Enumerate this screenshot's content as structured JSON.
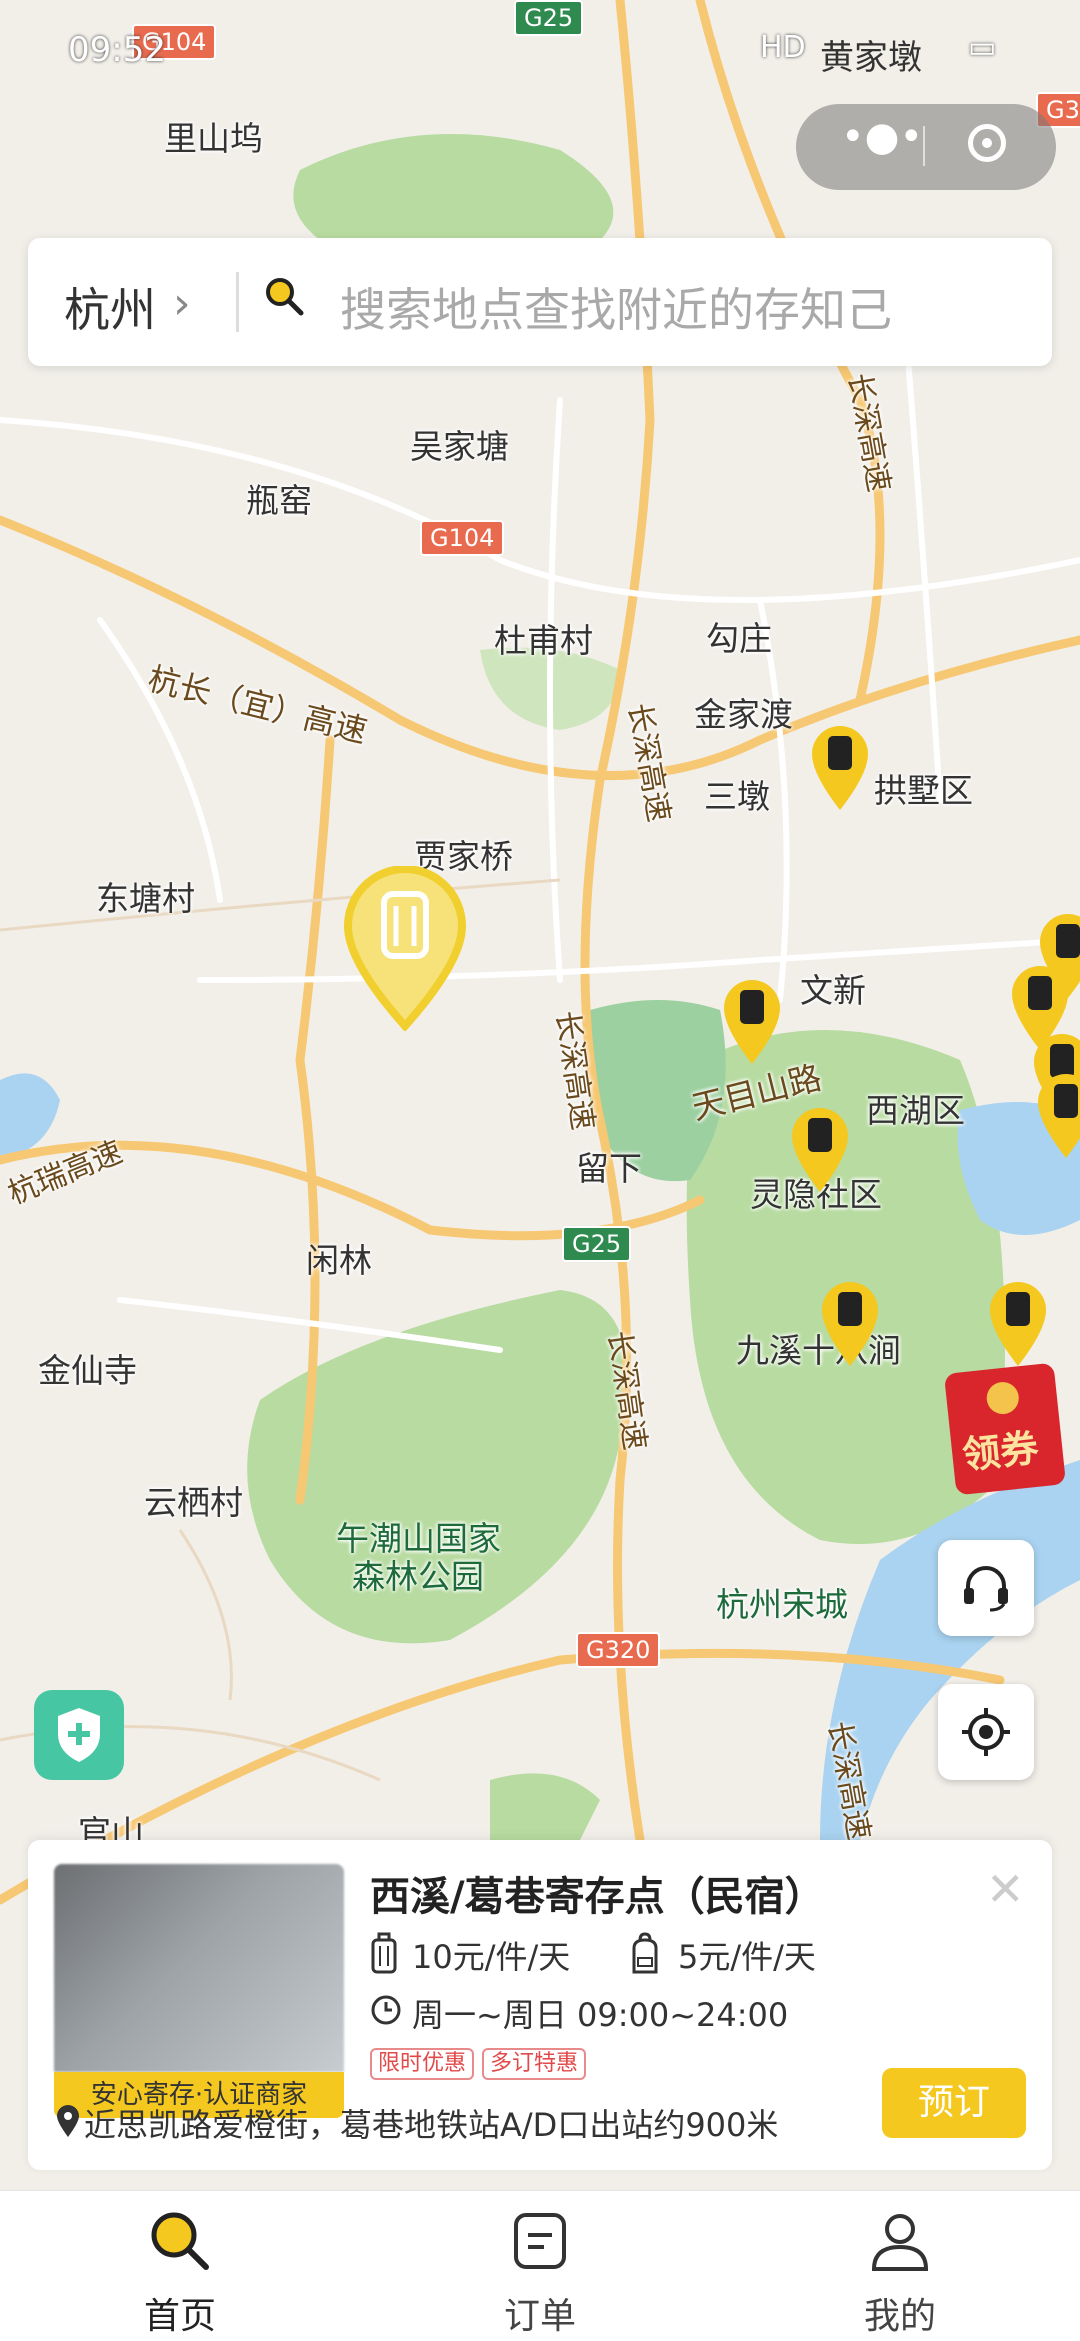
{
  "status_bar": {
    "time": "09:52",
    "carrier": "HD",
    "map_corner_label": "黄家墩"
  },
  "search": {
    "city": "杭州",
    "placeholder": "搜索地点查找附近的存知己"
  },
  "map": {
    "labels": [
      "里山坞",
      "吴家塘",
      "瓶窑",
      "杜甫村",
      "勾庄",
      "金家渡",
      "三墩",
      "拱墅区",
      "贾家桥",
      "东塘村",
      "文新",
      "天目山路",
      "西湖区",
      "留下",
      "灵隐社区",
      "闲林",
      "金仙寺",
      "九溪十八涧",
      "云栖村",
      "午潮山国家",
      "森林公园",
      "杭州宋城",
      "官山"
    ],
    "highway_labels": [
      "杭长（宜）高速",
      "长深高速",
      "杭瑞高速",
      "长深高速",
      "长深高速",
      "长深高速",
      "长深高速"
    ],
    "road_badges": [
      "G104",
      "G25",
      "G104",
      "G25",
      "G320",
      "G3"
    ]
  },
  "coupon": {
    "label": "领券"
  },
  "card": {
    "title": "西溪/葛巷寄存点（民宿）",
    "photo_band": "安心寄存·认证商家",
    "price_luggage": "10元/件/天",
    "price_backpack": "5元/件/天",
    "hours": "周一~周日 09:00~24:00",
    "tags": [
      "限时优惠",
      "多订特惠"
    ],
    "address": "近思凯路爱橙街，葛巷地铁站A/D口出站约900米",
    "book_label": "预订"
  },
  "tabs": [
    {
      "label": "首页",
      "icon": "search-icon",
      "active": true
    },
    {
      "label": "订单",
      "icon": "order-icon",
      "active": false
    },
    {
      "label": "我的",
      "icon": "profile-icon",
      "active": false
    }
  ],
  "colors": {
    "accent": "#f4c81f",
    "shield": "#47c6a4",
    "coupon": "#d9262d"
  }
}
